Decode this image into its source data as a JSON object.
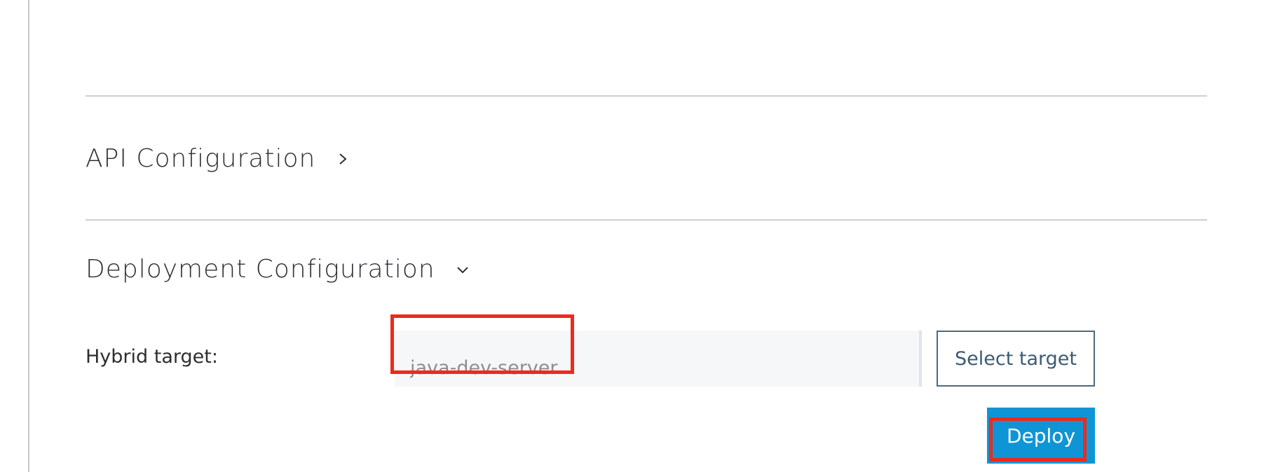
{
  "sections": {
    "api_configuration": {
      "title": "API Configuration",
      "chevron_icon": "chevron-right-icon",
      "expanded": false
    },
    "deployment_configuration": {
      "title": "Deployment Configuration",
      "chevron_icon": "chevron-down-icon",
      "expanded": true
    }
  },
  "deployment": {
    "hybrid_target_label": "Hybrid target:",
    "hybrid_target_value": "java-dev-server",
    "select_target_label": "Select target",
    "deploy_label": "Deploy"
  },
  "colors": {
    "deploy_button": "#0f95d6",
    "select_target_border": "#4d6a80",
    "highlight_box": "#ee2a1b",
    "input_background": "#f6f7f8"
  }
}
